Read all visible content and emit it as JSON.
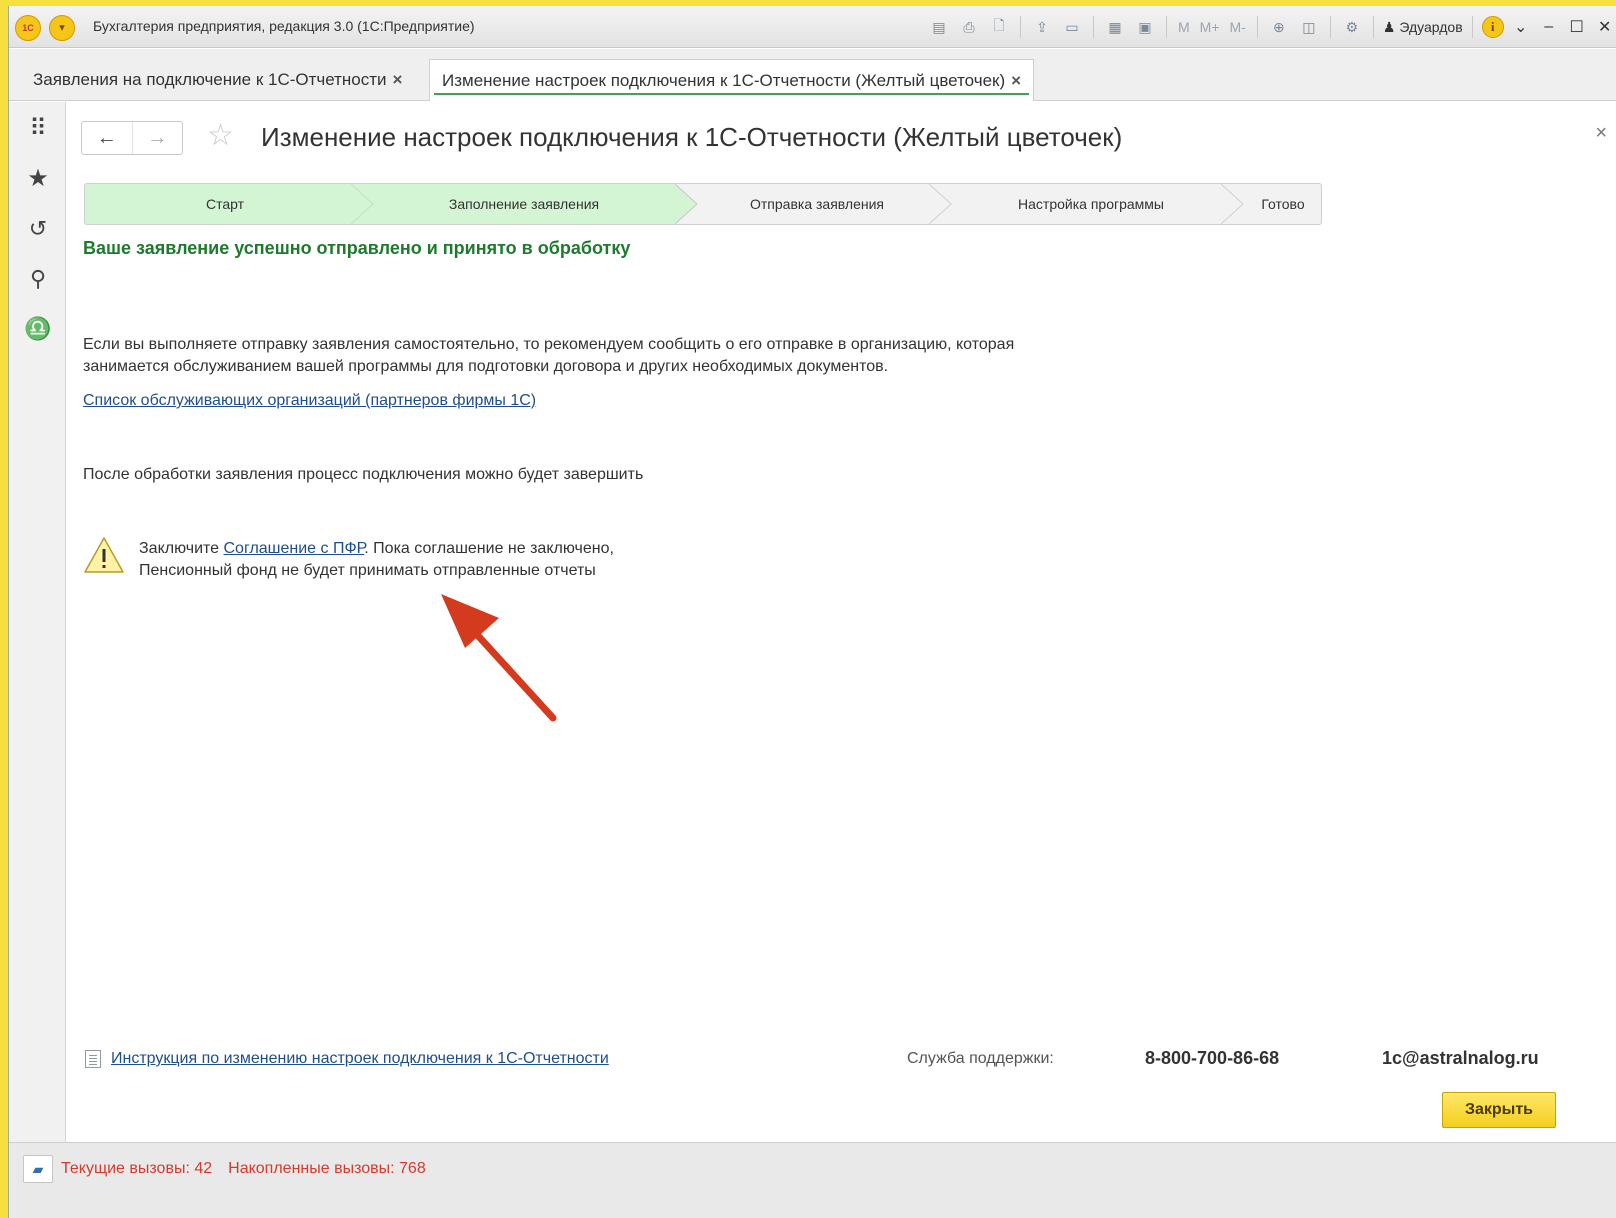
{
  "window": {
    "app_title": "Бухгалтерия предприятия, редакция 3.0  (1С:Предприятие)",
    "logo_text": "1С",
    "user_name": "Эдуардов",
    "toolbar_text": {
      "m": "M",
      "m_plus": "M+",
      "m_minus": "M-"
    },
    "icons": [
      "save-icon",
      "print-icon",
      "preview-icon",
      "upload-icon",
      "scan-icon",
      "calculator-icon",
      "calendar-icon",
      "zoom-icon",
      "panel-icon",
      "settings-icon",
      "info-icon"
    ]
  },
  "tabs": [
    {
      "label": "Заявления на подключение к 1С-Отчетности",
      "close": "×"
    },
    {
      "label": "Изменение настроек подключения к 1С-Отчетности (Желтый цветочек)",
      "close": "×",
      "active": true
    }
  ],
  "sidebar": {
    "items": [
      "apps-menu-icon",
      "favorites-icon",
      "history-icon",
      "search-icon",
      "notifications-icon"
    ]
  },
  "page": {
    "title": "Изменение настроек подключения к 1С-Отчетности (Желтый цветочек)",
    "steps": [
      {
        "label": "Старт",
        "done": true
      },
      {
        "label": "Заполнение заявления",
        "done": true
      },
      {
        "label": "Отправка заявления",
        "done": false
      },
      {
        "label": "Настройка программы",
        "done": false
      },
      {
        "label": "Готово",
        "done": false
      }
    ],
    "success_message": "Ваше заявление успешно отправлено и принято в обработку",
    "info_line1": "Если вы выполняете отправку заявления самостоятельно, то рекомендуем сообщить о его отправке в организацию, которая",
    "info_line2": "занимается обслуживанием вашей программы для подготовки договора и других необходимых документов.",
    "partners_link": "Список обслуживающих организаций (партнеров фирмы 1С)",
    "after_processing": "После обработки заявления процесс подключения можно будет завершить",
    "warning": {
      "prefix": "Заключите ",
      "link": "Соглашение с ПФР",
      "suffix": ". Пока соглашение не заключено,",
      "line2": "Пенсионный фонд не будет принимать отправленные отчеты"
    },
    "instruction_link": "Инструкция по изменению настроек подключения к 1С-Отчетности",
    "support_label": "Служба поддержки:",
    "support_phone": "8-800-700-86-68",
    "support_email": "1c@astralnalog.ru",
    "close_button": "Закрыть"
  },
  "statusbar": {
    "current_calls": "Текущие вызовы: 42",
    "accumulated_calls": "Накопленные вызовы: 768"
  },
  "colors": {
    "success_text": "#1f7a2e",
    "step_done": "#d3f5d3",
    "link": "#1f4e8c",
    "annotation_arrow": "#d43a1e",
    "close_button": "#f3cf1c"
  }
}
